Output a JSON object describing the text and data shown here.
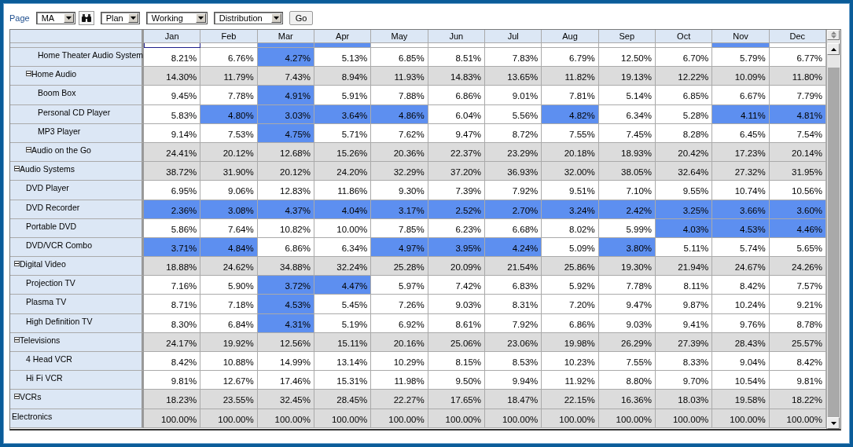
{
  "toolbar": {
    "page_label": "Page",
    "page_select": "MA",
    "selects": [
      "Plan",
      "Working",
      "Distribution"
    ],
    "go": "Go"
  },
  "table": {
    "months": [
      "Jan",
      "Feb",
      "Mar",
      "Apr",
      "May",
      "Jun",
      "Jul",
      "Aug",
      "Sep",
      "Oct",
      "Nov",
      "Dec"
    ],
    "clipped_row": [
      {
        "highlighted": false,
        "focused": true
      },
      {
        "highlighted": false,
        "focused": false
      },
      {
        "highlighted": true,
        "focused": false
      },
      {
        "highlighted": true,
        "focused": false
      },
      {
        "highlighted": false,
        "focused": false
      },
      {
        "highlighted": false,
        "focused": false
      },
      {
        "highlighted": false,
        "focused": false
      },
      {
        "highlighted": false,
        "focused": false
      },
      {
        "highlighted": false,
        "focused": false
      },
      {
        "highlighted": false,
        "focused": false
      },
      {
        "highlighted": true,
        "focused": false
      },
      {
        "highlighted": false,
        "focused": false
      }
    ],
    "tree": {
      "label": "Electronics",
      "cells": [
        {
          "text": "100.00%",
          "highlighted": false
        },
        {
          "text": "100.00%",
          "highlighted": false
        },
        {
          "text": "100.00%",
          "highlighted": false
        },
        {
          "text": "100.00%",
          "highlighted": false
        },
        {
          "text": "100.00%",
          "highlighted": false
        },
        {
          "text": "100.00%",
          "highlighted": false
        },
        {
          "text": "100.00%",
          "highlighted": false
        },
        {
          "text": "100.00%",
          "highlighted": false
        },
        {
          "text": "100.00%",
          "highlighted": false
        },
        {
          "text": "100.00%",
          "highlighted": false
        },
        {
          "text": "100.00%",
          "highlighted": false
        },
        {
          "text": "100.00%",
          "highlighted": false
        }
      ],
      "children": [
        {
          "label": "Audio Systems",
          "expanded": true,
          "cells": [
            {
              "text": "38.72%",
              "highlighted": false
            },
            {
              "text": "31.90%",
              "highlighted": false
            },
            {
              "text": "20.12%",
              "highlighted": false
            },
            {
              "text": "24.20%",
              "highlighted": false
            },
            {
              "text": "32.29%",
              "highlighted": false
            },
            {
              "text": "37.20%",
              "highlighted": false
            },
            {
              "text": "36.93%",
              "highlighted": false
            },
            {
              "text": "32.00%",
              "highlighted": false
            },
            {
              "text": "38.05%",
              "highlighted": false
            },
            {
              "text": "32.64%",
              "highlighted": false
            },
            {
              "text": "27.32%",
              "highlighted": false
            },
            {
              "text": "31.95%",
              "highlighted": false
            }
          ],
          "children": [
            {
              "label": "Home Audio",
              "expanded": true,
              "cells": [
                {
                  "text": "14.30%",
                  "highlighted": false
                },
                {
                  "text": "11.79%",
                  "highlighted": false
                },
                {
                  "text": "7.43%",
                  "highlighted": false
                },
                {
                  "text": "8.94%",
                  "highlighted": false
                },
                {
                  "text": "11.93%",
                  "highlighted": false
                },
                {
                  "text": "14.83%",
                  "highlighted": false
                },
                {
                  "text": "13.65%",
                  "highlighted": false
                },
                {
                  "text": "11.82%",
                  "highlighted": false
                },
                {
                  "text": "19.13%",
                  "highlighted": false
                },
                {
                  "text": "12.22%",
                  "highlighted": false
                },
                {
                  "text": "10.09%",
                  "highlighted": false
                },
                {
                  "text": "11.80%",
                  "highlighted": false
                }
              ],
              "children": [
                {
                  "label": "Home Theater Audio System",
                  "cells": [
                    {
                      "text": "8.21%",
                      "highlighted": false
                    },
                    {
                      "text": "6.76%",
                      "highlighted": false
                    },
                    {
                      "text": "4.27%",
                      "highlighted": true
                    },
                    {
                      "text": "5.13%",
                      "highlighted": false
                    },
                    {
                      "text": "6.85%",
                      "highlighted": false
                    },
                    {
                      "text": "8.51%",
                      "highlighted": false
                    },
                    {
                      "text": "7.83%",
                      "highlighted": false
                    },
                    {
                      "text": "6.79%",
                      "highlighted": false
                    },
                    {
                      "text": "12.50%",
                      "highlighted": false
                    },
                    {
                      "text": "6.70%",
                      "highlighted": false
                    },
                    {
                      "text": "5.79%",
                      "highlighted": false
                    },
                    {
                      "text": "6.77%",
                      "highlighted": false
                    }
                  ]
                }
              ]
            },
            {
              "label": "Audio on the Go",
              "expanded": true,
              "cells": [
                {
                  "text": "24.41%",
                  "highlighted": false
                },
                {
                  "text": "20.12%",
                  "highlighted": false
                },
                {
                  "text": "12.68%",
                  "highlighted": false
                },
                {
                  "text": "15.26%",
                  "highlighted": false
                },
                {
                  "text": "20.36%",
                  "highlighted": false
                },
                {
                  "text": "22.37%",
                  "highlighted": false
                },
                {
                  "text": "23.29%",
                  "highlighted": false
                },
                {
                  "text": "20.18%",
                  "highlighted": false
                },
                {
                  "text": "18.93%",
                  "highlighted": false
                },
                {
                  "text": "20.42%",
                  "highlighted": false
                },
                {
                  "text": "17.23%",
                  "highlighted": false
                },
                {
                  "text": "20.14%",
                  "highlighted": false
                }
              ],
              "children": [
                {
                  "label": "Boom Box",
                  "cells": [
                    {
                      "text": "9.45%",
                      "highlighted": false
                    },
                    {
                      "text": "7.78%",
                      "highlighted": false
                    },
                    {
                      "text": "4.91%",
                      "highlighted": true
                    },
                    {
                      "text": "5.91%",
                      "highlighted": false
                    },
                    {
                      "text": "7.88%",
                      "highlighted": false
                    },
                    {
                      "text": "6.86%",
                      "highlighted": false
                    },
                    {
                      "text": "9.01%",
                      "highlighted": false
                    },
                    {
                      "text": "7.81%",
                      "highlighted": false
                    },
                    {
                      "text": "5.14%",
                      "highlighted": false
                    },
                    {
                      "text": "6.85%",
                      "highlighted": false
                    },
                    {
                      "text": "6.67%",
                      "highlighted": false
                    },
                    {
                      "text": "7.79%",
                      "highlighted": false
                    }
                  ]
                },
                {
                  "label": "Personal CD Player",
                  "cells": [
                    {
                      "text": "5.83%",
                      "highlighted": false
                    },
                    {
                      "text": "4.80%",
                      "highlighted": true
                    },
                    {
                      "text": "3.03%",
                      "highlighted": true
                    },
                    {
                      "text": "3.64%",
                      "highlighted": true
                    },
                    {
                      "text": "4.86%",
                      "highlighted": true
                    },
                    {
                      "text": "6.04%",
                      "highlighted": false
                    },
                    {
                      "text": "5.56%",
                      "highlighted": false
                    },
                    {
                      "text": "4.82%",
                      "highlighted": true
                    },
                    {
                      "text": "6.34%",
                      "highlighted": false
                    },
                    {
                      "text": "5.28%",
                      "highlighted": false
                    },
                    {
                      "text": "4.11%",
                      "highlighted": true
                    },
                    {
                      "text": "4.81%",
                      "highlighted": true
                    }
                  ]
                },
                {
                  "label": "MP3 Player",
                  "cells": [
                    {
                      "text": "9.14%",
                      "highlighted": false
                    },
                    {
                      "text": "7.53%",
                      "highlighted": false
                    },
                    {
                      "text": "4.75%",
                      "highlighted": true
                    },
                    {
                      "text": "5.71%",
                      "highlighted": false
                    },
                    {
                      "text": "7.62%",
                      "highlighted": false
                    },
                    {
                      "text": "9.47%",
                      "highlighted": false
                    },
                    {
                      "text": "8.72%",
                      "highlighted": false
                    },
                    {
                      "text": "7.55%",
                      "highlighted": false
                    },
                    {
                      "text": "7.45%",
                      "highlighted": false
                    },
                    {
                      "text": "8.28%",
                      "highlighted": false
                    },
                    {
                      "text": "6.45%",
                      "highlighted": false
                    },
                    {
                      "text": "7.54%",
                      "highlighted": false
                    }
                  ]
                }
              ]
            }
          ]
        },
        {
          "label": "Digital Video",
          "expanded": true,
          "cells": [
            {
              "text": "18.88%",
              "highlighted": false
            },
            {
              "text": "24.62%",
              "highlighted": false
            },
            {
              "text": "34.88%",
              "highlighted": false
            },
            {
              "text": "32.24%",
              "highlighted": false
            },
            {
              "text": "25.28%",
              "highlighted": false
            },
            {
              "text": "20.09%",
              "highlighted": false
            },
            {
              "text": "21.54%",
              "highlighted": false
            },
            {
              "text": "25.86%",
              "highlighted": false
            },
            {
              "text": "19.30%",
              "highlighted": false
            },
            {
              "text": "21.94%",
              "highlighted": false
            },
            {
              "text": "24.67%",
              "highlighted": false
            },
            {
              "text": "24.26%",
              "highlighted": false
            }
          ],
          "children": [
            {
              "label": "DVD Player",
              "cells": [
                {
                  "text": "6.95%",
                  "highlighted": false
                },
                {
                  "text": "9.06%",
                  "highlighted": false
                },
                {
                  "text": "12.83%",
                  "highlighted": false
                },
                {
                  "text": "11.86%",
                  "highlighted": false
                },
                {
                  "text": "9.30%",
                  "highlighted": false
                },
                {
                  "text": "7.39%",
                  "highlighted": false
                },
                {
                  "text": "7.92%",
                  "highlighted": false
                },
                {
                  "text": "9.51%",
                  "highlighted": false
                },
                {
                  "text": "7.10%",
                  "highlighted": false
                },
                {
                  "text": "9.55%",
                  "highlighted": false
                },
                {
                  "text": "10.74%",
                  "highlighted": false
                },
                {
                  "text": "10.56%",
                  "highlighted": false
                }
              ]
            },
            {
              "label": "DVD Recorder",
              "cells": [
                {
                  "text": "2.36%",
                  "highlighted": true
                },
                {
                  "text": "3.08%",
                  "highlighted": true
                },
                {
                  "text": "4.37%",
                  "highlighted": true
                },
                {
                  "text": "4.04%",
                  "highlighted": true
                },
                {
                  "text": "3.17%",
                  "highlighted": true
                },
                {
                  "text": "2.52%",
                  "highlighted": true
                },
                {
                  "text": "2.70%",
                  "highlighted": true
                },
                {
                  "text": "3.24%",
                  "highlighted": true
                },
                {
                  "text": "2.42%",
                  "highlighted": true
                },
                {
                  "text": "3.25%",
                  "highlighted": true
                },
                {
                  "text": "3.66%",
                  "highlighted": true
                },
                {
                  "text": "3.60%",
                  "highlighted": true
                }
              ]
            },
            {
              "label": "Portable DVD",
              "cells": [
                {
                  "text": "5.86%",
                  "highlighted": false
                },
                {
                  "text": "7.64%",
                  "highlighted": false
                },
                {
                  "text": "10.82%",
                  "highlighted": false
                },
                {
                  "text": "10.00%",
                  "highlighted": false
                },
                {
                  "text": "7.85%",
                  "highlighted": false
                },
                {
                  "text": "6.23%",
                  "highlighted": false
                },
                {
                  "text": "6.68%",
                  "highlighted": false
                },
                {
                  "text": "8.02%",
                  "highlighted": false
                },
                {
                  "text": "5.99%",
                  "highlighted": false
                },
                {
                  "text": "4.03%",
                  "highlighted": true
                },
                {
                  "text": "4.53%",
                  "highlighted": true
                },
                {
                  "text": "4.46%",
                  "highlighted": true
                }
              ]
            },
            {
              "label": "DVD/VCR Combo",
              "cells": [
                {
                  "text": "3.71%",
                  "highlighted": true
                },
                {
                  "text": "4.84%",
                  "highlighted": true
                },
                {
                  "text": "6.86%",
                  "highlighted": false
                },
                {
                  "text": "6.34%",
                  "highlighted": false
                },
                {
                  "text": "4.97%",
                  "highlighted": true
                },
                {
                  "text": "3.95%",
                  "highlighted": true
                },
                {
                  "text": "4.24%",
                  "highlighted": true
                },
                {
                  "text": "5.09%",
                  "highlighted": false
                },
                {
                  "text": "3.80%",
                  "highlighted": true
                },
                {
                  "text": "5.11%",
                  "highlighted": false
                },
                {
                  "text": "5.74%",
                  "highlighted": false
                },
                {
                  "text": "5.65%",
                  "highlighted": false
                }
              ]
            }
          ]
        },
        {
          "label": "Televisions",
          "expanded": true,
          "cells": [
            {
              "text": "24.17%",
              "highlighted": false
            },
            {
              "text": "19.92%",
              "highlighted": false
            },
            {
              "text": "12.56%",
              "highlighted": false
            },
            {
              "text": "15.11%",
              "highlighted": false
            },
            {
              "text": "20.16%",
              "highlighted": false
            },
            {
              "text": "25.06%",
              "highlighted": false
            },
            {
              "text": "23.06%",
              "highlighted": false
            },
            {
              "text": "19.98%",
              "highlighted": false
            },
            {
              "text": "26.29%",
              "highlighted": false
            },
            {
              "text": "27.39%",
              "highlighted": false
            },
            {
              "text": "28.43%",
              "highlighted": false
            },
            {
              "text": "25.57%",
              "highlighted": false
            }
          ],
          "children": [
            {
              "label": "Projection TV",
              "cells": [
                {
                  "text": "7.16%",
                  "highlighted": false
                },
                {
                  "text": "5.90%",
                  "highlighted": false
                },
                {
                  "text": "3.72%",
                  "highlighted": true
                },
                {
                  "text": "4.47%",
                  "highlighted": true
                },
                {
                  "text": "5.97%",
                  "highlighted": false
                },
                {
                  "text": "7.42%",
                  "highlighted": false
                },
                {
                  "text": "6.83%",
                  "highlighted": false
                },
                {
                  "text": "5.92%",
                  "highlighted": false
                },
                {
                  "text": "7.78%",
                  "highlighted": false
                },
                {
                  "text": "8.11%",
                  "highlighted": false
                },
                {
                  "text": "8.42%",
                  "highlighted": false
                },
                {
                  "text": "7.57%",
                  "highlighted": false
                }
              ]
            },
            {
              "label": "Plasma TV",
              "cells": [
                {
                  "text": "8.71%",
                  "highlighted": false
                },
                {
                  "text": "7.18%",
                  "highlighted": false
                },
                {
                  "text": "4.53%",
                  "highlighted": true
                },
                {
                  "text": "5.45%",
                  "highlighted": false
                },
                {
                  "text": "7.26%",
                  "highlighted": false
                },
                {
                  "text": "9.03%",
                  "highlighted": false
                },
                {
                  "text": "8.31%",
                  "highlighted": false
                },
                {
                  "text": "7.20%",
                  "highlighted": false
                },
                {
                  "text": "9.47%",
                  "highlighted": false
                },
                {
                  "text": "9.87%",
                  "highlighted": false
                },
                {
                  "text": "10.24%",
                  "highlighted": false
                },
                {
                  "text": "9.21%",
                  "highlighted": false
                }
              ]
            },
            {
              "label": "High Definition TV",
              "cells": [
                {
                  "text": "8.30%",
                  "highlighted": false
                },
                {
                  "text": "6.84%",
                  "highlighted": false
                },
                {
                  "text": "4.31%",
                  "highlighted": true
                },
                {
                  "text": "5.19%",
                  "highlighted": false
                },
                {
                  "text": "6.92%",
                  "highlighted": false
                },
                {
                  "text": "8.61%",
                  "highlighted": false
                },
                {
                  "text": "7.92%",
                  "highlighted": false
                },
                {
                  "text": "6.86%",
                  "highlighted": false
                },
                {
                  "text": "9.03%",
                  "highlighted": false
                },
                {
                  "text": "9.41%",
                  "highlighted": false
                },
                {
                  "text": "9.76%",
                  "highlighted": false
                },
                {
                  "text": "8.78%",
                  "highlighted": false
                }
              ]
            }
          ]
        },
        {
          "label": "VCRs",
          "expanded": true,
          "cells": [
            {
              "text": "18.23%",
              "highlighted": false
            },
            {
              "text": "23.55%",
              "highlighted": false
            },
            {
              "text": "32.45%",
              "highlighted": false
            },
            {
              "text": "28.45%",
              "highlighted": false
            },
            {
              "text": "22.27%",
              "highlighted": false
            },
            {
              "text": "17.65%",
              "highlighted": false
            },
            {
              "text": "18.47%",
              "highlighted": false
            },
            {
              "text": "22.15%",
              "highlighted": false
            },
            {
              "text": "16.36%",
              "highlighted": false
            },
            {
              "text": "18.03%",
              "highlighted": false
            },
            {
              "text": "19.58%",
              "highlighted": false
            },
            {
              "text": "18.22%",
              "highlighted": false
            }
          ],
          "children": [
            {
              "label": "4 Head VCR",
              "cells": [
                {
                  "text": "8.42%",
                  "highlighted": false
                },
                {
                  "text": "10.88%",
                  "highlighted": false
                },
                {
                  "text": "14.99%",
                  "highlighted": false
                },
                {
                  "text": "13.14%",
                  "highlighted": false
                },
                {
                  "text": "10.29%",
                  "highlighted": false
                },
                {
                  "text": "8.15%",
                  "highlighted": false
                },
                {
                  "text": "8.53%",
                  "highlighted": false
                },
                {
                  "text": "10.23%",
                  "highlighted": false
                },
                {
                  "text": "7.55%",
                  "highlighted": false
                },
                {
                  "text": "8.33%",
                  "highlighted": false
                },
                {
                  "text": "9.04%",
                  "highlighted": false
                },
                {
                  "text": "8.42%",
                  "highlighted": false
                }
              ]
            },
            {
              "label": "Hi Fi VCR",
              "cells": [
                {
                  "text": "9.81%",
                  "highlighted": false
                },
                {
                  "text": "12.67%",
                  "highlighted": false
                },
                {
                  "text": "17.46%",
                  "highlighted": false
                },
                {
                  "text": "15.31%",
                  "highlighted": false
                },
                {
                  "text": "11.98%",
                  "highlighted": false
                },
                {
                  "text": "9.50%",
                  "highlighted": false
                },
                {
                  "text": "9.94%",
                  "highlighted": false
                },
                {
                  "text": "11.92%",
                  "highlighted": false
                },
                {
                  "text": "8.80%",
                  "highlighted": false
                },
                {
                  "text": "9.70%",
                  "highlighted": false
                },
                {
                  "text": "10.54%",
                  "highlighted": false
                },
                {
                  "text": "9.81%",
                  "highlighted": false
                }
              ]
            }
          ]
        }
      ]
    }
  }
}
